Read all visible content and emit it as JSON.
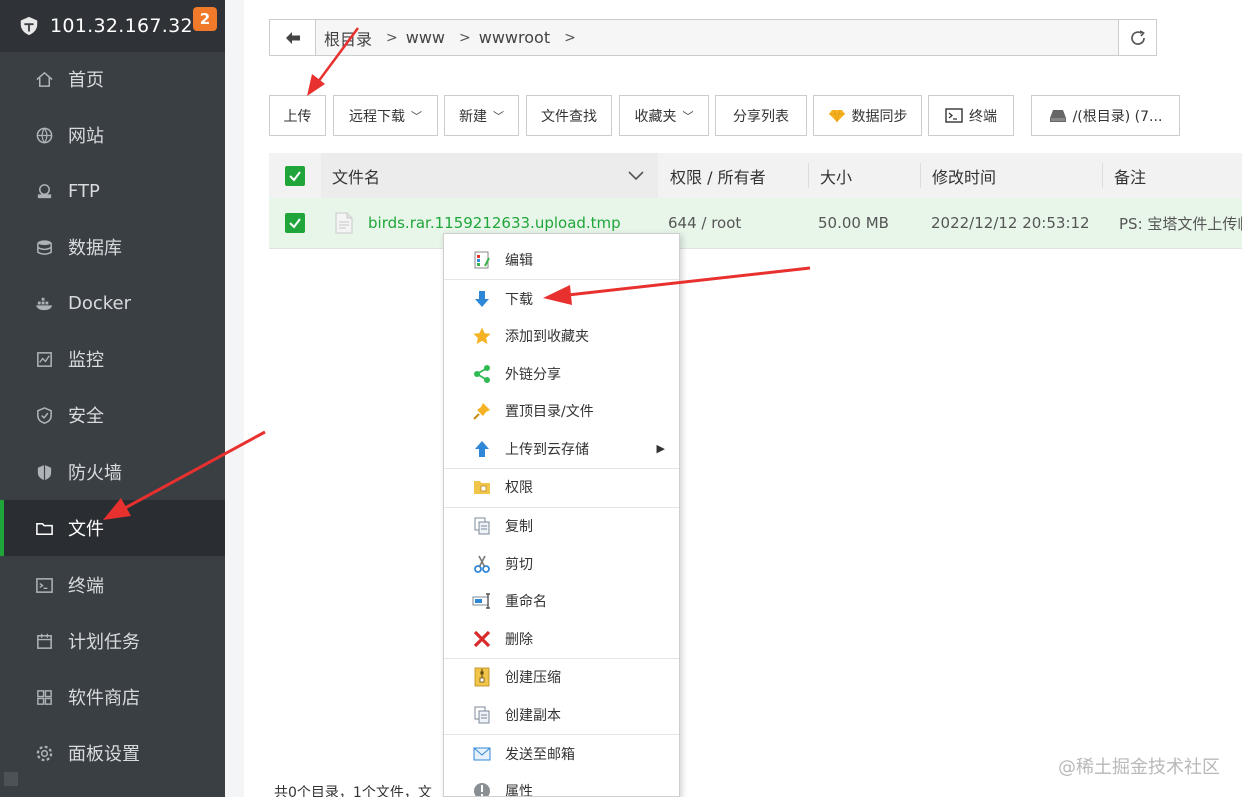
{
  "sidebar": {
    "ip": "101.32.167.32",
    "badge": "2",
    "items": [
      {
        "label": "首页",
        "icon": "home-icon"
      },
      {
        "label": "网站",
        "icon": "globe-icon"
      },
      {
        "label": "FTP",
        "icon": "ftp-icon"
      },
      {
        "label": "数据库",
        "icon": "database-icon"
      },
      {
        "label": "Docker",
        "icon": "docker-icon"
      },
      {
        "label": "监控",
        "icon": "monitor-icon"
      },
      {
        "label": "安全",
        "icon": "shield-check-icon"
      },
      {
        "label": "防火墙",
        "icon": "firewall-icon"
      },
      {
        "label": "文件",
        "icon": "folder-icon"
      },
      {
        "label": "终端",
        "icon": "terminal-icon"
      },
      {
        "label": "计划任务",
        "icon": "calendar-icon"
      },
      {
        "label": "软件商店",
        "icon": "grid-icon"
      },
      {
        "label": "面板设置",
        "icon": "gear-icon"
      }
    ],
    "active_index": 8
  },
  "path": {
    "crumbs": [
      "根目录",
      "www",
      "wwwroot"
    ]
  },
  "toolbar": {
    "upload": "上传",
    "remote_download": "远程下载",
    "new": "新建",
    "file_search": "文件查找",
    "favorites": "收藏夹",
    "share_list": "分享列表",
    "data_sync": "数据同步",
    "terminal": "终端",
    "disk": "/(根目录) (7..."
  },
  "table": {
    "headers": {
      "name": "文件名",
      "perm": "权限 / 所有者",
      "size": "大小",
      "mtime": "修改时间",
      "note": "备注"
    },
    "rows": [
      {
        "name": "birds.rar.1159212633.upload.tmp",
        "perm": "644 / root",
        "size": "50.00 MB",
        "mtime": "2022/12/12 20:53:12",
        "note": "PS: 宝塔文件上传临"
      }
    ],
    "footer": "共0个目录，1个文件，文"
  },
  "context_menu": {
    "items": [
      {
        "label": "编辑",
        "icon": "edit-icon"
      },
      {
        "label": "下载",
        "icon": "download-icon"
      },
      {
        "label": "添加到收藏夹",
        "icon": "star-icon"
      },
      {
        "label": "外链分享",
        "icon": "share-icon"
      },
      {
        "label": "置顶目录/文件",
        "icon": "pin-icon"
      },
      {
        "label": "上传到云存储",
        "icon": "upload-cloud-icon"
      },
      {
        "label": "权限",
        "icon": "permission-icon"
      },
      {
        "label": "复制",
        "icon": "copy-icon"
      },
      {
        "label": "剪切",
        "icon": "scissors-icon"
      },
      {
        "label": "重命名",
        "icon": "rename-icon"
      },
      {
        "label": "删除",
        "icon": "delete-icon"
      },
      {
        "label": "创建压缩",
        "icon": "zip-icon"
      },
      {
        "label": "创建副本",
        "icon": "duplicate-icon"
      },
      {
        "label": "发送至邮箱",
        "icon": "mail-icon"
      },
      {
        "label": "属性",
        "icon": "info-icon"
      }
    ]
  },
  "watermark": "@稀土掘金技术社区",
  "colors": {
    "sidebar_bg": "#3a3f44",
    "accent_green": "#20a53a",
    "badge_orange": "#f0792a",
    "arrow_red": "#e8302e"
  }
}
